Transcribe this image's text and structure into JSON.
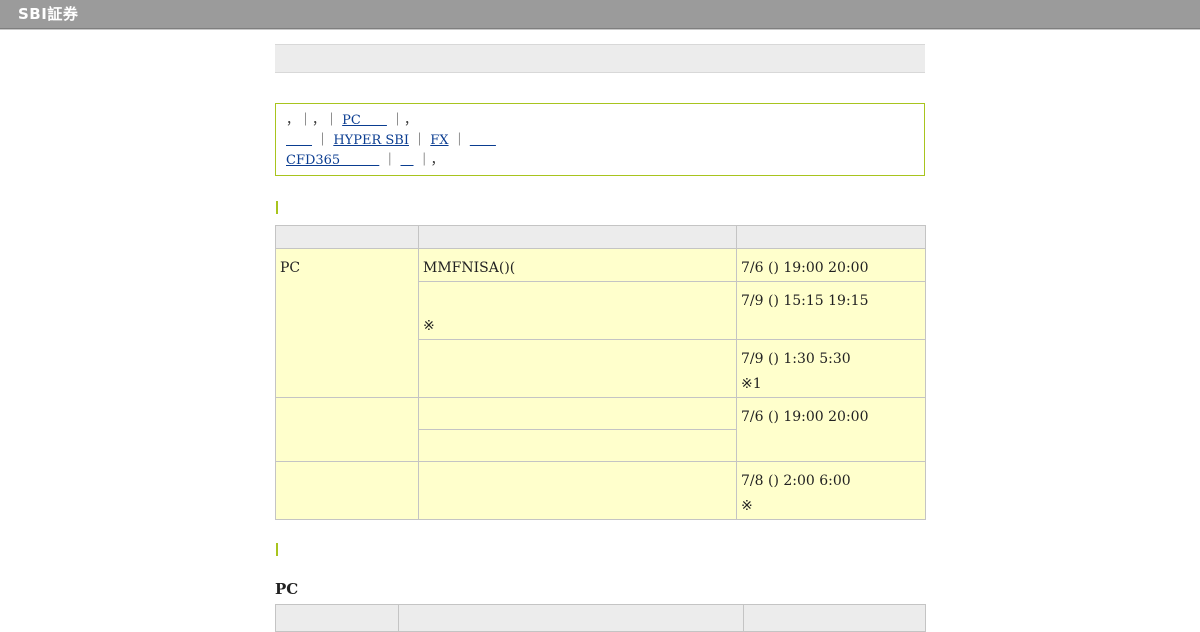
{
  "header": {
    "logo_text": "SBI証券"
  },
  "notice": {
    "line1": {
      "prefix": "，｜，｜",
      "pc_link": "PC＿＿",
      "suffix": "｜，"
    },
    "line2": {
      "link1": "＿＿",
      "sep1": "｜",
      "hyper_sbi_link": "HYPER SBI",
      "sep2": "｜",
      "fx_link": "FX",
      "sep3": "｜",
      "link2": "＿＿"
    },
    "line3": {
      "cfd_link": "CFD365＿＿＿",
      "sep1": "｜",
      "link": "＿",
      "suffix": "｜，"
    }
  },
  "schedule_table": {
    "headers": [
      "",
      "",
      ""
    ],
    "rows": [
      {
        "service": "PC",
        "items": [
          {
            "content": "MMFNISA()(",
            "time": "7/6 () 19:00  20:00",
            "note": ""
          },
          {
            "content": "",
            "content_note": "※",
            "time": "7/9 () 15:15  19:15",
            "note": ""
          },
          {
            "content": "",
            "time": "7/9 () 1:30  5:30",
            "note": "※1"
          }
        ]
      },
      {
        "service": "",
        "items": [
          {
            "content": "",
            "time": "7/6 () 19:00  20:00",
            "note": ""
          },
          {
            "content": ""
          }
        ]
      },
      {
        "service": "",
        "items": [
          {
            "content": "",
            "time": "7/8 () 2:00  6:00",
            "note": "※"
          }
        ]
      }
    ]
  },
  "second_section": {
    "heading": "PC",
    "headers": [
      "",
      "",
      ""
    ]
  },
  "colors": {
    "accent": "#a8c41e",
    "header_bar": "#9b9b9b",
    "cell_bg": "#ffffcc",
    "link": "#0b3d91"
  }
}
